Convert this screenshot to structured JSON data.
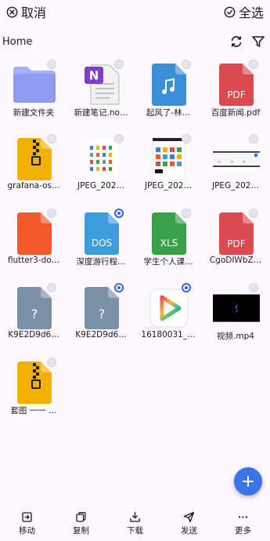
{
  "topbar": {
    "cancel_label": "取消",
    "select_all_label": "全选"
  },
  "path": {
    "label": "Home"
  },
  "files": [
    {
      "name": "新建文件夹",
      "type": "folder",
      "selected": false,
      "icon": "folder-icon"
    },
    {
      "name": "新建笔记.no…",
      "type": "onenote",
      "selected": false,
      "icon": "onenote-file-icon",
      "ext": "N"
    },
    {
      "name": "起风了-林…",
      "type": "audio",
      "selected": false,
      "icon": "music-file-icon"
    },
    {
      "name": "百度新闻.pdf",
      "type": "pdf",
      "selected": false,
      "icon": "pdf-file-icon",
      "ext": "PDF"
    },
    {
      "name": "grafana-os…",
      "type": "zip",
      "selected": false,
      "icon": "zip-file-icon"
    },
    {
      "name": "JPEG_202…",
      "type": "image",
      "selected": false,
      "icon": "image-thumbnail",
      "variant": "a"
    },
    {
      "name": "JPEG_202…",
      "type": "image",
      "selected": false,
      "icon": "image-thumbnail",
      "variant": "b"
    },
    {
      "name": "JPEG_202…",
      "type": "image",
      "selected": false,
      "icon": "image-thumbnail",
      "variant": "c"
    },
    {
      "name": "flutter3-do…",
      "type": "code",
      "selected": false,
      "icon": "code-file-icon",
      "ext": "</>"
    },
    {
      "name": "深度游行程…",
      "type": "doc",
      "selected": true,
      "icon": "doc-file-icon",
      "ext": "DOS"
    },
    {
      "name": "学生个人课…",
      "type": "xls",
      "selected": false,
      "icon": "xls-file-icon",
      "ext": "XLS"
    },
    {
      "name": "CgoDIWbZ…",
      "type": "pdf",
      "selected": false,
      "icon": "pdf-file-icon",
      "ext": "PDF"
    },
    {
      "name": "K9E2D9d6…",
      "type": "unknown",
      "selected": false,
      "icon": "unknown-file-icon",
      "ext": "?"
    },
    {
      "name": "K9E2D9d6…",
      "type": "unknown",
      "selected": true,
      "icon": "unknown-file-icon",
      "ext": "?"
    },
    {
      "name": "16180031_…",
      "type": "app",
      "selected": true,
      "icon": "video-player-app-icon"
    },
    {
      "name": "视频.mp4",
      "type": "video",
      "selected": false,
      "icon": "video-thumbnail"
    },
    {
      "name": "套图 一一 …",
      "type": "zip",
      "selected": false,
      "icon": "zip-file-icon"
    }
  ],
  "bottom_nav": [
    {
      "label": "移动",
      "icon": "move-icon"
    },
    {
      "label": "复制",
      "icon": "copy-icon"
    },
    {
      "label": "下载",
      "icon": "download-icon"
    },
    {
      "label": "发送",
      "icon": "send-icon"
    },
    {
      "label": "更多",
      "icon": "more-icon"
    }
  ],
  "colors": {
    "accent": "#3367d6",
    "fab": "#3b73e8",
    "folder": "#8f9cf2",
    "audio": "#3a8fd6",
    "pdf": "#dc4a4f",
    "zip": "#f2b100",
    "code": "#f2592a",
    "doc": "#3d9ddd",
    "xls": "#3aa14a",
    "unknown": "#7b8fa6"
  }
}
